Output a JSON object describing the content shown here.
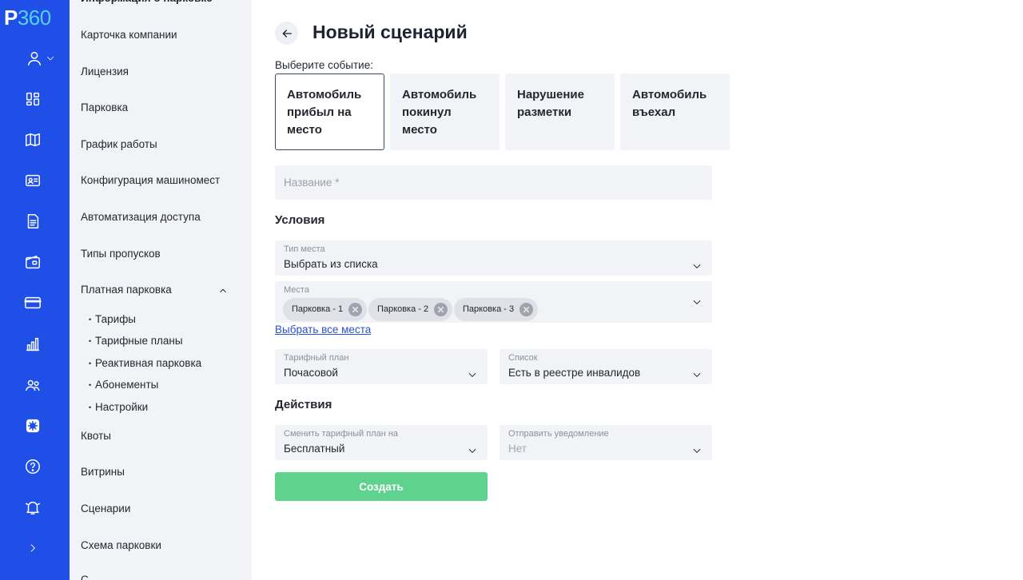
{
  "brand": {
    "logo_letter": "P",
    "logo_number": "360",
    "logo_accent": "#58d0e8",
    "rail_color": "#1f4fe6"
  },
  "rail": {
    "icons": [
      "user-icon",
      "dashboard-icon",
      "map-icon",
      "id-card-icon",
      "document-icon",
      "wallet-icon",
      "credit-card-icon",
      "bar-chart-icon",
      "users-icon",
      "settings-icon",
      "help-icon",
      "bell-alert-icon",
      "chevron-right-icon"
    ]
  },
  "subnav": {
    "top_partial": "Информация о парковке",
    "items": [
      "Карточка компании",
      "Лицензия",
      "Парковка",
      "График работы",
      "Конфигурация машиномест",
      "Автоматизация доступа",
      "Типы пропусков",
      "Платная парковка"
    ],
    "paid_sub": [
      "Тарифы",
      "Тарифные планы",
      "Реактивная парковка",
      "Абонементы",
      "Настройки"
    ],
    "items_after": [
      "Квоты",
      "Витрины",
      "Сценарии",
      "Схема парковки"
    ],
    "bottom_partial": "С"
  },
  "main": {
    "title": "Новый сценарий",
    "event_label": "Выберите событие:",
    "events": [
      "Автомобиль прибыл на место",
      "Автомобиль покинул место",
      "Нарушение разметки",
      "Автомобиль въехал"
    ],
    "name_placeholder": "Название *",
    "conditions_title": "Условия",
    "place_type": {
      "label": "Тип места",
      "value": "Выбрать из списка"
    },
    "places": {
      "label": "Места",
      "chips": [
        "Парковка - 1",
        "Парковка - 2",
        "Парковка - 3"
      ]
    },
    "select_all_link": "Выбрать все места",
    "tariff_plan": {
      "label": "Тарифный план",
      "value": "Почасовой"
    },
    "list": {
      "label": "Список",
      "value": "Есть в реестре инвалидов"
    },
    "actions_title": "Действия",
    "change_plan": {
      "label": "Сменить тарифный план на",
      "value": "Бесплатный"
    },
    "notify": {
      "label": "Отправить уведомление",
      "value": "Нет"
    },
    "submit": "Создать",
    "submit_color": "#5fd38e"
  }
}
